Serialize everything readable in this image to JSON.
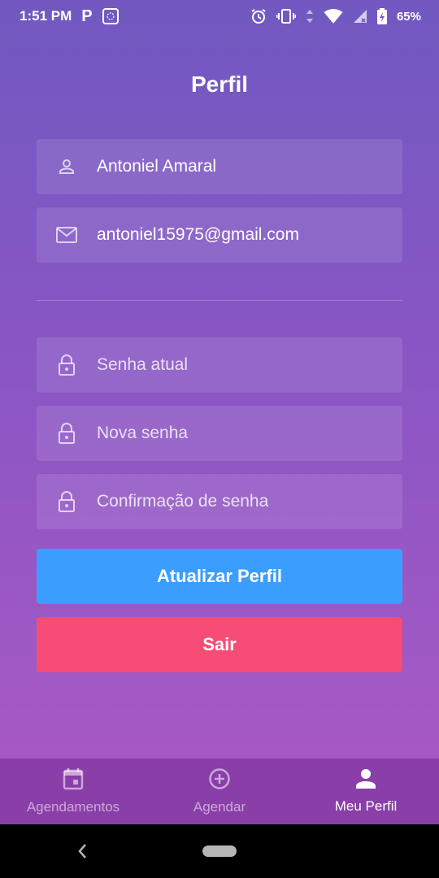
{
  "status_bar": {
    "time": "1:51 PM",
    "app_letter": "P",
    "battery": "65%"
  },
  "header": {
    "title": "Perfil"
  },
  "profile": {
    "name": "Antoniel Amaral",
    "email": "antoniel15975@gmail.com"
  },
  "password": {
    "current_placeholder": "Senha atual",
    "new_placeholder": "Nova senha",
    "confirm_placeholder": "Confirmação de senha"
  },
  "actions": {
    "update_label": "Atualizar Perfil",
    "logout_label": "Sair"
  },
  "tabs": [
    {
      "label": "Agendamentos",
      "icon": "calendar-icon",
      "active": false
    },
    {
      "label": "Agendar",
      "icon": "add-circle-icon",
      "active": false
    },
    {
      "label": "Meu Perfil",
      "icon": "person-icon",
      "active": true
    }
  ],
  "colors": {
    "gradient_top": "#7159c1",
    "gradient_bottom": "#ab59c4",
    "update_button": "#3b9eff",
    "logout_button": "#f64c75",
    "tab_bar": "#8a3ea8"
  }
}
